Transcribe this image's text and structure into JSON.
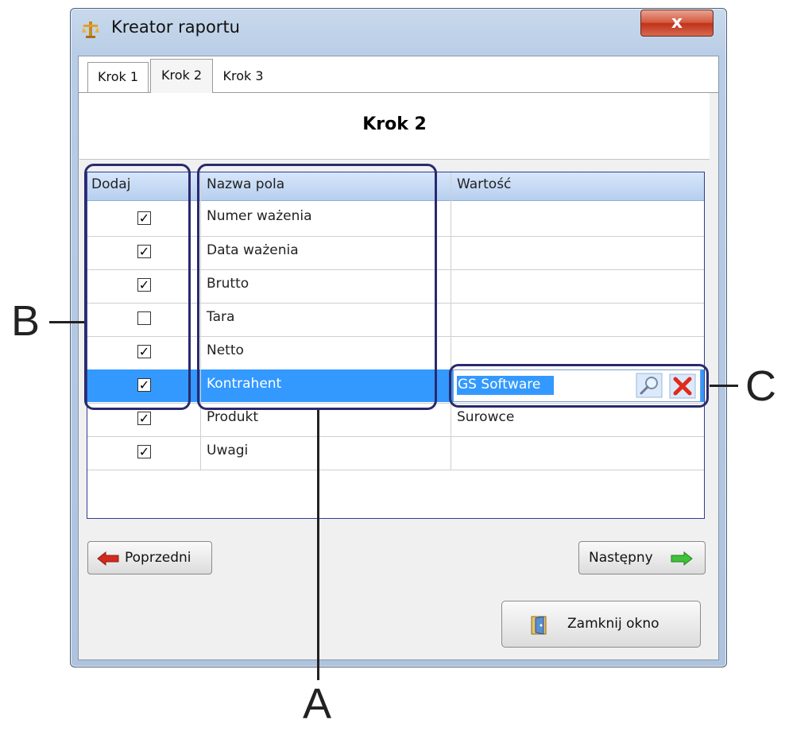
{
  "window": {
    "title": "Kreator raportu",
    "close_glyph": "x"
  },
  "tabs": [
    {
      "label": "Krok 1",
      "active": false
    },
    {
      "label": "Krok 2",
      "active": true
    },
    {
      "label": "Krok 3",
      "active": false
    }
  ],
  "page_title": "Krok 2",
  "grid": {
    "columns": [
      "Dodaj",
      "Nazwa pola",
      "Wartość"
    ],
    "rows": [
      {
        "checked": true,
        "name": "Numer ważenia",
        "value": ""
      },
      {
        "checked": true,
        "name": "Data ważenia",
        "value": ""
      },
      {
        "checked": true,
        "name": "Brutto",
        "value": ""
      },
      {
        "checked": false,
        "name": "Tara",
        "value": ""
      },
      {
        "checked": true,
        "name": "Netto",
        "value": ""
      },
      {
        "checked": true,
        "name": "Kontrahent",
        "value": "GS Software",
        "selected": true
      },
      {
        "checked": true,
        "name": "Produkt",
        "value": "Surowce"
      },
      {
        "checked": true,
        "name": "Uwagi",
        "value": ""
      }
    ]
  },
  "buttons": {
    "prev": "Poprzedni",
    "next": "Następny",
    "close": "Zamknij okno"
  },
  "callouts": {
    "a": "A",
    "b": "B",
    "c": "C"
  },
  "check_glyph": "✓",
  "colors": {
    "selection": "#3399ff",
    "callout_border": "#2a2a6e",
    "header_gradient_top": "#d7e6fb"
  },
  "icons": [
    "app-scale-icon",
    "close-icon",
    "magnifier-icon",
    "clear-x-icon",
    "arrow-left-icon",
    "arrow-right-icon",
    "exit-door-icon"
  ]
}
